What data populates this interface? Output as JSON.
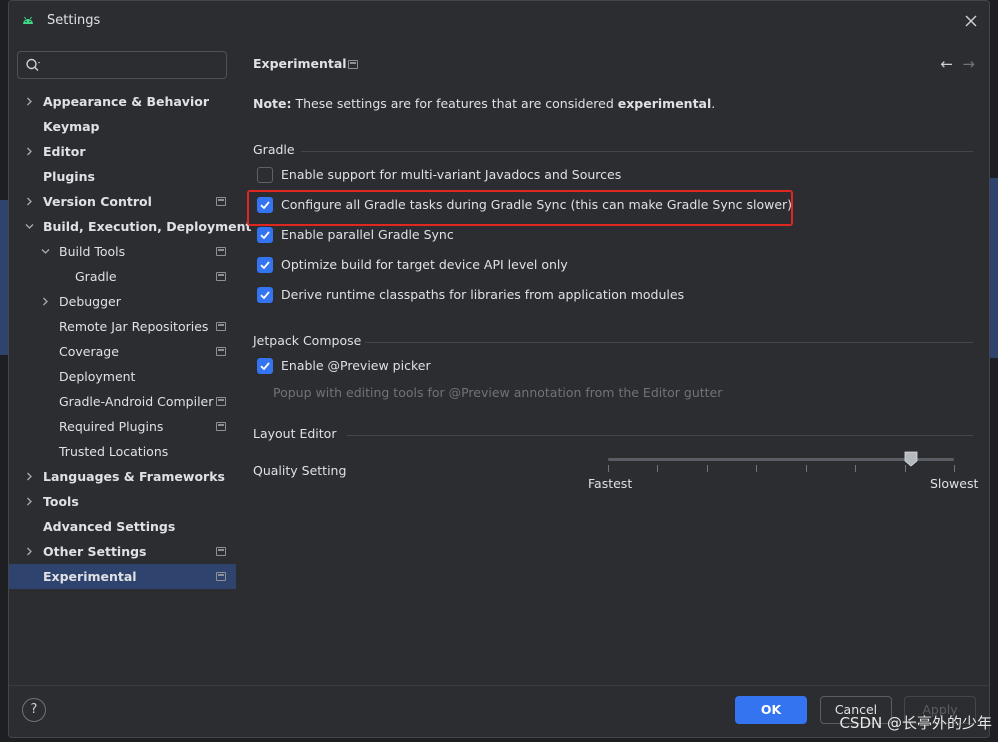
{
  "window": {
    "title": "Settings"
  },
  "sidebar": {
    "search_placeholder": "",
    "items": [
      {
        "label": "Appearance & Behavior",
        "bold": true,
        "chevron": "right",
        "indent": 0,
        "project": false
      },
      {
        "label": "Keymap",
        "bold": true,
        "chevron": "none",
        "indent": 0,
        "project": false
      },
      {
        "label": "Editor",
        "bold": true,
        "chevron": "right",
        "indent": 0,
        "project": false
      },
      {
        "label": "Plugins",
        "bold": true,
        "chevron": "none",
        "indent": 0,
        "project": false
      },
      {
        "label": "Version Control",
        "bold": true,
        "chevron": "right",
        "indent": 0,
        "project": true
      },
      {
        "label": "Build, Execution, Deployment",
        "bold": true,
        "chevron": "down",
        "indent": 0,
        "project": false
      },
      {
        "label": "Build Tools",
        "bold": false,
        "chevron": "down",
        "indent": 1,
        "project": true
      },
      {
        "label": "Gradle",
        "bold": false,
        "chevron": "none",
        "indent": 2,
        "project": true
      },
      {
        "label": "Debugger",
        "bold": false,
        "chevron": "right",
        "indent": 1,
        "project": false
      },
      {
        "label": "Remote Jar Repositories",
        "bold": false,
        "chevron": "none",
        "indent": 1,
        "project": true
      },
      {
        "label": "Coverage",
        "bold": false,
        "chevron": "none",
        "indent": 1,
        "project": true
      },
      {
        "label": "Deployment",
        "bold": false,
        "chevron": "none",
        "indent": 1,
        "project": false
      },
      {
        "label": "Gradle-Android Compiler",
        "bold": false,
        "chevron": "none",
        "indent": 1,
        "project": true
      },
      {
        "label": "Required Plugins",
        "bold": false,
        "chevron": "none",
        "indent": 1,
        "project": true
      },
      {
        "label": "Trusted Locations",
        "bold": false,
        "chevron": "none",
        "indent": 1,
        "project": false
      },
      {
        "label": "Languages & Frameworks",
        "bold": true,
        "chevron": "right",
        "indent": 0,
        "project": false
      },
      {
        "label": "Tools",
        "bold": true,
        "chevron": "right",
        "indent": 0,
        "project": false
      },
      {
        "label": "Advanced Settings",
        "bold": true,
        "chevron": "none",
        "indent": 0,
        "project": false
      },
      {
        "label": "Other Settings",
        "bold": true,
        "chevron": "right",
        "indent": 0,
        "project": true
      },
      {
        "label": "Experimental",
        "bold": true,
        "chevron": "none",
        "indent": 0,
        "project": true,
        "selected": true
      }
    ]
  },
  "main": {
    "breadcrumb": "Experimental",
    "note": {
      "prefix": "Note:",
      "text": " These settings are for features that are considered ",
      "emphasis": "experimental",
      "suffix": "."
    },
    "gradle": {
      "title": "Gradle",
      "options": [
        {
          "label": "Enable support for multi-variant Javadocs and Sources",
          "checked": false
        },
        {
          "label": "Configure all Gradle tasks during Gradle Sync (this can make Gradle Sync slower)",
          "checked": true
        },
        {
          "label": "Enable parallel Gradle Sync",
          "checked": true
        },
        {
          "label": "Optimize build for target device API level only",
          "checked": true
        },
        {
          "label": "Derive runtime classpaths for libraries from application modules",
          "checked": true
        }
      ]
    },
    "compose": {
      "title": "Jetpack Compose",
      "option": {
        "label": "Enable @Preview picker",
        "checked": true
      },
      "hint": "Popup with editing tools for @Preview annotation from the Editor gutter"
    },
    "layout_editor": {
      "title": "Layout Editor",
      "quality_label": "Quality Setting",
      "min_label": "Fastest",
      "max_label": "Slowest",
      "ticks": 5,
      "value_fraction": 0.875
    }
  },
  "footer": {
    "ok": "OK",
    "cancel": "Cancel",
    "apply": "Apply",
    "help": "?"
  },
  "watermark": "CSDN @长亭外的少年",
  "colors": {
    "accent": "#3574f0",
    "selection": "#2e436e",
    "highlight_box": "#e0271f"
  }
}
